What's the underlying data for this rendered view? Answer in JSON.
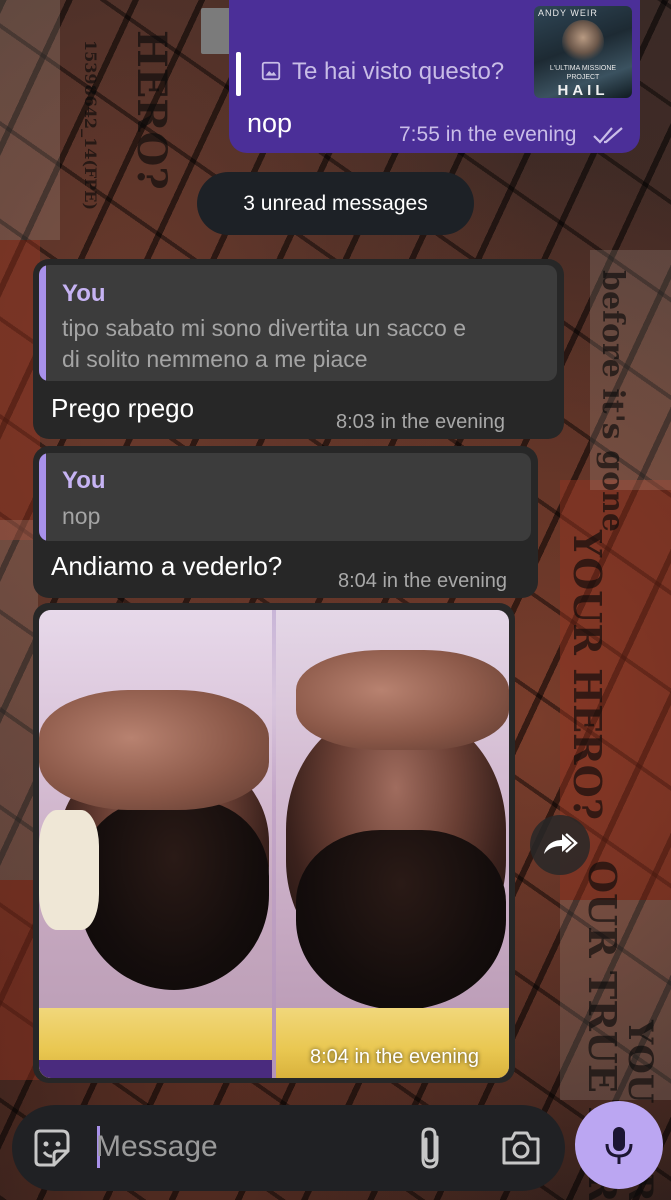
{
  "chat": {
    "top_message": {
      "reply_preview": "Te hai visto questo?",
      "thumbnail_author": "ANDY WEIR",
      "thumbnail_subtitle": "L'ULTIMA MISSIONE PROJECT",
      "thumbnail_title": "HAIL",
      "text": "nop",
      "time": "7:55 in the evening",
      "status_icon": "double-check-icon"
    },
    "unread_label": "3 unread messages",
    "messages": [
      {
        "quote_author": "You",
        "quote_text_line1": "tipo sabato mi sono divertita un sacco e",
        "quote_text_line2": "di solito nemmeno a me piace",
        "text": "Prego rpego",
        "time": "8:03 in the evening"
      },
      {
        "quote_author": "You",
        "quote_text_line1": "nop",
        "text": "Andiamo a vederlo?",
        "time": "8:04 in the evening"
      },
      {
        "type": "image",
        "description_icon": "meme-photo",
        "time": "8:04 in the evening"
      }
    ]
  },
  "input": {
    "placeholder": "Message",
    "icons": [
      "sticker-icon",
      "paperclip-icon",
      "camera-icon",
      "microphone-icon"
    ]
  },
  "wallpaper": {
    "texts": [
      "HERO?",
      "15398642_14(FPE)",
      "before it's gone",
      "YOUR HERO?",
      "OUR TRUE HERO?",
      "YOU HERO"
    ]
  },
  "colors": {
    "outgoing_bubble": "#4b2f98",
    "incoming_bubble": "#272727",
    "quote_accent": "#a891ea",
    "mic_button": "#bba6f2",
    "unread_pill": "#1d2126"
  }
}
